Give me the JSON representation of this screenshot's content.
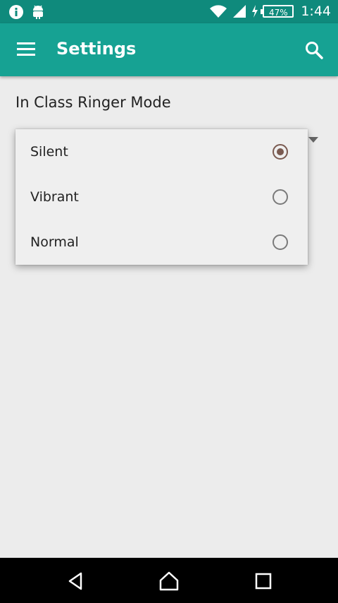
{
  "status_bar": {
    "icons_left": [
      "info-icon",
      "android-icon"
    ],
    "icons_right": [
      "wifi-icon",
      "signal-icon",
      "charging-icon",
      "battery-icon"
    ],
    "battery_percent": "47%",
    "time": "1:44"
  },
  "app_bar": {
    "title": "Settings",
    "menu_icon": "hamburger-menu-icon",
    "search_icon": "search-icon",
    "color": "#16a293"
  },
  "preference": {
    "title": "In Class Ringer Mode"
  },
  "dialog": {
    "options": [
      {
        "label": "Silent",
        "selected": true
      },
      {
        "label": "Vibrant",
        "selected": false
      },
      {
        "label": "Normal",
        "selected": false
      }
    ],
    "accent_color": "#7a5a50"
  },
  "nav_bar": {
    "buttons": [
      "back-icon",
      "home-icon",
      "recents-icon"
    ]
  }
}
